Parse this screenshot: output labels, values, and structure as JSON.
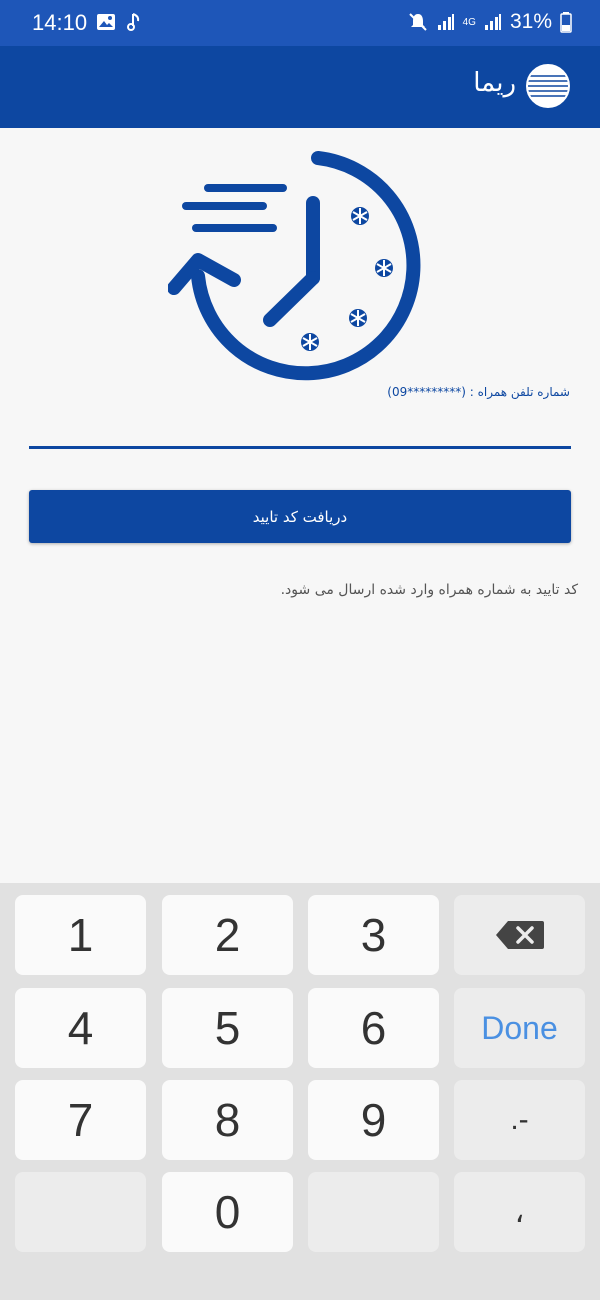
{
  "status_bar": {
    "time": "14:10",
    "network": "4G",
    "battery": "31%"
  },
  "app_bar": {
    "title": "ریما"
  },
  "form": {
    "phone_label": "شماره تلفن همراه : (*********09)",
    "code_value": "",
    "submit_label": "دریافت کد تایید",
    "hint": "کد تایید به شماره همراه وارد شده ارسال می شود."
  },
  "keyboard": {
    "keys": [
      "1",
      "2",
      "3",
      "4",
      "5",
      "6",
      "7",
      "8",
      "9",
      "0"
    ],
    "done_label": "Done",
    "symbols_label": ".-",
    "comma_label": "،"
  },
  "colors": {
    "primary": "#0d47a1",
    "status_bar": "#1e56b8",
    "done_text": "#4a90e2"
  }
}
